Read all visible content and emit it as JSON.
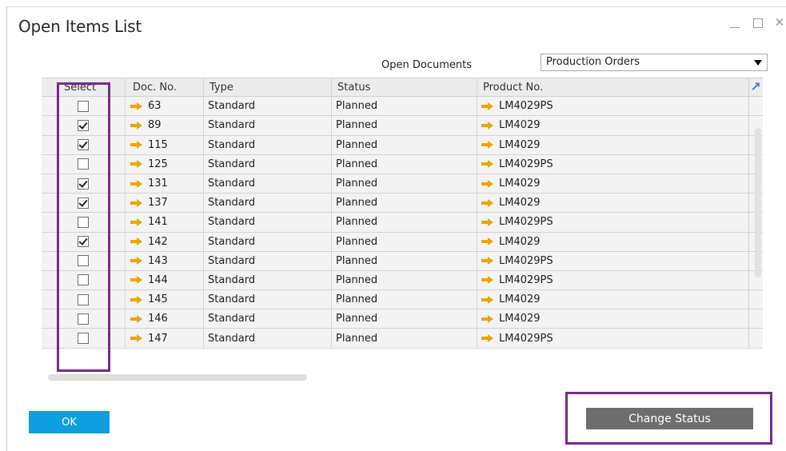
{
  "window": {
    "title": "Open Items List",
    "controls": [
      "minimize",
      "maximize",
      "close"
    ],
    "close_glyph": "✕"
  },
  "filter": {
    "label": "Open Documents",
    "selected": "Production Orders"
  },
  "table": {
    "headers": {
      "select": "Select",
      "doc_no": "Doc. No.",
      "type": "Type",
      "status": "Status",
      "product_no": "Product No."
    },
    "rows": [
      {
        "selected": false,
        "doc_no": "63",
        "type": "Standard",
        "status": "Planned",
        "product_no": "LM4029PS"
      },
      {
        "selected": true,
        "doc_no": "89",
        "type": "Standard",
        "status": "Planned",
        "product_no": "LM4029"
      },
      {
        "selected": true,
        "doc_no": "115",
        "type": "Standard",
        "status": "Planned",
        "product_no": "LM4029"
      },
      {
        "selected": false,
        "doc_no": "125",
        "type": "Standard",
        "status": "Planned",
        "product_no": "LM4029PS"
      },
      {
        "selected": true,
        "doc_no": "131",
        "type": "Standard",
        "status": "Planned",
        "product_no": "LM4029"
      },
      {
        "selected": true,
        "doc_no": "137",
        "type": "Standard",
        "status": "Planned",
        "product_no": "LM4029"
      },
      {
        "selected": false,
        "doc_no": "141",
        "type": "Standard",
        "status": "Planned",
        "product_no": "LM4029PS"
      },
      {
        "selected": true,
        "doc_no": "142",
        "type": "Standard",
        "status": "Planned",
        "product_no": "LM4029"
      },
      {
        "selected": false,
        "doc_no": "143",
        "type": "Standard",
        "status": "Planned",
        "product_no": "LM4029PS"
      },
      {
        "selected": false,
        "doc_no": "144",
        "type": "Standard",
        "status": "Planned",
        "product_no": "LM4029PS"
      },
      {
        "selected": false,
        "doc_no": "145",
        "type": "Standard",
        "status": "Planned",
        "product_no": "LM4029"
      },
      {
        "selected": false,
        "doc_no": "146",
        "type": "Standard",
        "status": "Planned",
        "product_no": "LM4029"
      },
      {
        "selected": false,
        "doc_no": "147",
        "type": "Standard",
        "status": "Planned",
        "product_no": "LM4029PS"
      }
    ]
  },
  "buttons": {
    "ok": "OK",
    "change_status": "Change Status"
  },
  "colors": {
    "link_arrow": "#f0a30a",
    "ok_button": "#0f9ee0",
    "change_status_button": "#6e6e6e",
    "highlight_border": "#7a2a8a"
  }
}
